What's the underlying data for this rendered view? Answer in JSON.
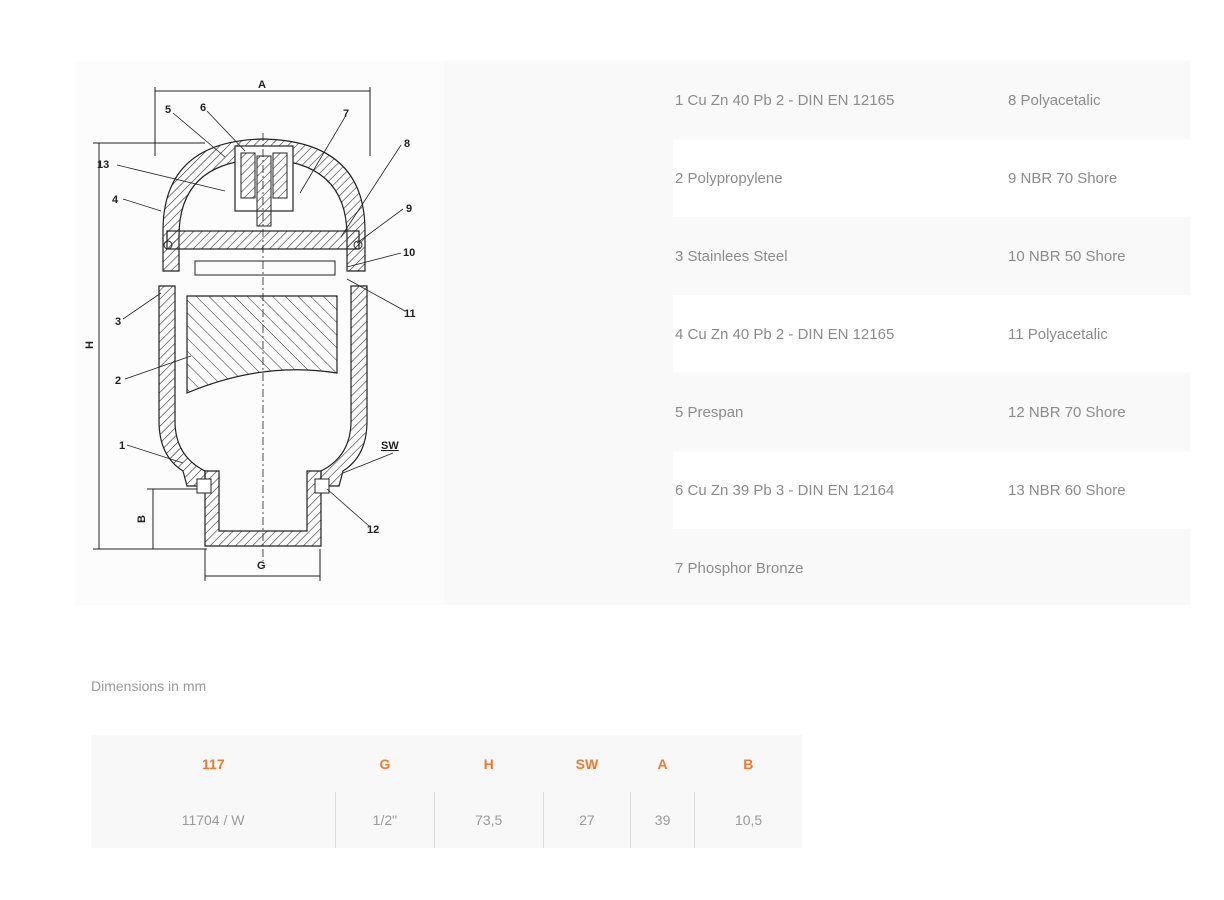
{
  "drawing": {
    "labels": {
      "A": "A",
      "H": "H",
      "B": "B",
      "G": "G",
      "SW": "SW",
      "n1": "1",
      "n2": "2",
      "n3": "3",
      "n4": "4",
      "n5": "5",
      "n6": "6",
      "n7": "7",
      "n8": "8",
      "n9": "9",
      "n10": "10",
      "n11": "11",
      "n12": "12",
      "n13": "13"
    }
  },
  "materials": [
    {
      "left": "1 Cu Zn 40 Pb 2 - DIN EN 12165",
      "right": "8 Polyacetalic"
    },
    {
      "left": "2 Polypropylene",
      "right": "9 NBR 70 Shore"
    },
    {
      "left": "3 Stainlees Steel",
      "right": "10 NBR 50 Shore"
    },
    {
      "left": "4 Cu Zn 40 Pb 2 - DIN EN 12165",
      "right": "11 Polyacetalic"
    },
    {
      "left": "5 Prespan",
      "right": "12 NBR 70 Shore"
    },
    {
      "left": "6 Cu Zn 39 Pb 3 - DIN EN 12164",
      "right": "13 NBR 60 Shore"
    },
    {
      "left": "7 Phosphor Bronze",
      "right": ""
    }
  ],
  "dimensions": {
    "caption": "Dimensions in mm",
    "headers": [
      "117",
      "G",
      "H",
      "SW",
      "A",
      "B"
    ],
    "rows": [
      [
        "11704 / W",
        "1/2\"",
        "73,5",
        "27",
        "39",
        "10,5"
      ]
    ],
    "header_color": "#ef7b2a"
  }
}
